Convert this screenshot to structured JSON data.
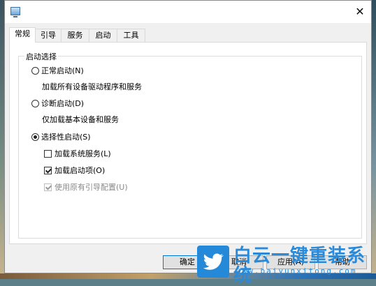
{
  "window": {
    "close_glyph": "✕"
  },
  "tabs": [
    {
      "label": "常规",
      "active": true
    },
    {
      "label": "引导",
      "active": false
    },
    {
      "label": "服务",
      "active": false
    },
    {
      "label": "启动",
      "active": false
    },
    {
      "label": "工具",
      "active": false
    }
  ],
  "startup": {
    "group_title": "启动选择",
    "normal": {
      "label": "正常启动(N)",
      "desc": "加载所有设备驱动程序和服务",
      "selected": false
    },
    "diagnostic": {
      "label": "诊断启动(D)",
      "desc": "仅加载基本设备和服务",
      "selected": false
    },
    "selective": {
      "label": "选择性启动(S)",
      "selected": true,
      "options": [
        {
          "label": "加载系统服务(L)",
          "checked": false,
          "enabled": true
        },
        {
          "label": "加载启动项(O)",
          "checked": true,
          "enabled": true
        },
        {
          "label": "使用原有引导配置(U)",
          "checked": true,
          "enabled": false
        }
      ]
    }
  },
  "buttons": {
    "ok": "确定",
    "cancel": "取消",
    "apply": "应用(A)",
    "help": "帮助"
  },
  "watermark": {
    "brand": "白云一键重装系统",
    "url": "www.baiyunxitong.com",
    "color": "#2b8ad8"
  }
}
